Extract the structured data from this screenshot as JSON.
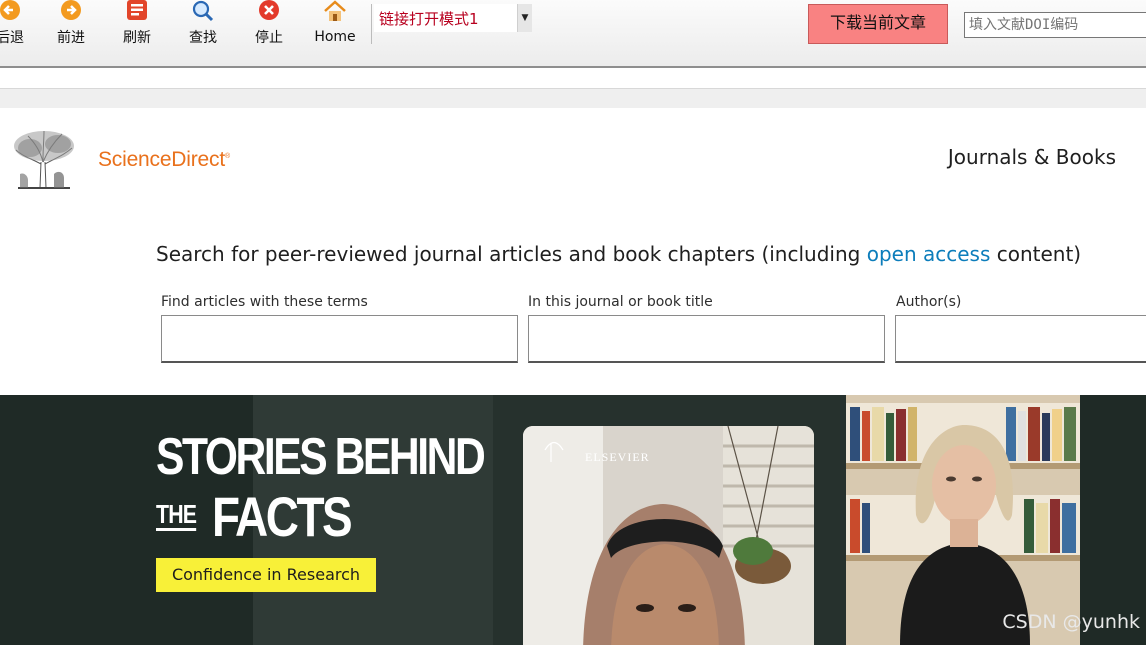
{
  "toolbar": {
    "buttons": [
      {
        "label": "后退",
        "icon": "back-arrow-icon"
      },
      {
        "label": "前进",
        "icon": "forward-arrow-icon"
      },
      {
        "label": "刷新",
        "icon": "refresh-icon"
      },
      {
        "label": "查找",
        "icon": "magnifier-icon"
      },
      {
        "label": "停止",
        "icon": "stop-icon"
      },
      {
        "label": "Home",
        "icon": "home-icon"
      }
    ],
    "mode_select": {
      "value": "链接打开模式1"
    },
    "download_label": "下载当前文章",
    "doi_placeholder": "填入文献DOI编码"
  },
  "site": {
    "brand": "ScienceDirect",
    "nav": "Journals & Books",
    "headline_pre": "Search for peer-reviewed journal articles and book chapters (including ",
    "headline_link": "open access",
    "headline_post": " content)",
    "fields": [
      {
        "label": "Find articles with these terms"
      },
      {
        "label": "In this journal or book title"
      },
      {
        "label": "Author(s)"
      }
    ]
  },
  "banner": {
    "line1": "STORIES BEHIND",
    "line2_small": "THE",
    "line2_big": "FACTS",
    "tag": "Confidence in Research",
    "video_logo": "ELSEVIER"
  },
  "watermark": "CSDN @yunhk",
  "colors": {
    "brand": "#e9711c",
    "link": "#0c7dbb",
    "download_bg": "#f98282",
    "tag_bg": "#f8f038"
  }
}
